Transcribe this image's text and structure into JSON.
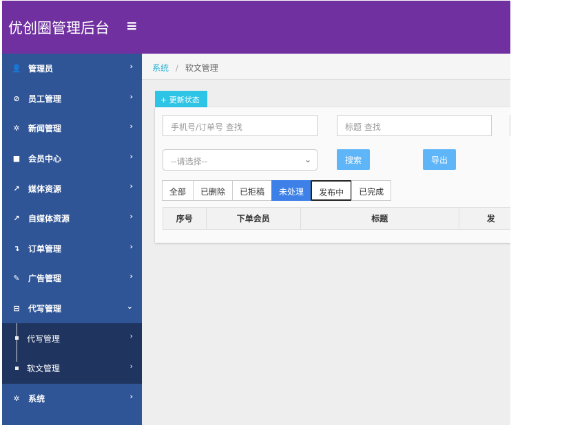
{
  "header": {
    "title": "优创圈管理后台",
    "menu_icon": "≡"
  },
  "sidebar": {
    "items": [
      {
        "label": "管理员",
        "icon": "user-icon",
        "glyph": "👤"
      },
      {
        "label": "员工管理",
        "icon": "compass-icon",
        "glyph": "⊘"
      },
      {
        "label": "新闻管理",
        "icon": "gear-icon",
        "glyph": "✲"
      },
      {
        "label": "会员中心",
        "icon": "video-icon",
        "glyph": "■"
      },
      {
        "label": "媒体资源",
        "icon": "share-icon",
        "glyph": "↗"
      },
      {
        "label": "自媒体资源",
        "icon": "share-icon",
        "glyph": "↗"
      },
      {
        "label": "订单管理",
        "icon": "arrow-down-icon",
        "glyph": "↴"
      },
      {
        "label": "广告管理",
        "icon": "edit-icon",
        "glyph": "✎"
      },
      {
        "label": "代写管理",
        "icon": "minus-square-icon",
        "glyph": "⊟"
      }
    ],
    "sub_items": [
      {
        "label": "代写管理"
      },
      {
        "label": "软文管理"
      }
    ],
    "last": {
      "label": "系统",
      "icon": "gear-icon",
      "glyph": "✲"
    },
    "chevron": "›",
    "chevron_open": "⌄"
  },
  "breadcrumb": {
    "root": "系统",
    "sep": "/",
    "current": "软文管理"
  },
  "update_button": "+ 更新状态",
  "filters": {
    "phone_placeholder": "手机号/订单号 查找",
    "title_placeholder": "标题 查找",
    "select_value": "--请选择--",
    "search": "搜索",
    "export": "导出"
  },
  "tabs": [
    {
      "label": "全部"
    },
    {
      "label": "已删除"
    },
    {
      "label": "已拒稿"
    },
    {
      "label": "未处理",
      "active": true
    },
    {
      "label": "发布中"
    },
    {
      "label": "已完成"
    }
  ],
  "table": {
    "headers": [
      "序号",
      "下单会员",
      "标题",
      "发"
    ]
  },
  "colors": {
    "header": "#7030a0",
    "sidebar": "#2f5597",
    "active_tab": "#3d80e8"
  }
}
